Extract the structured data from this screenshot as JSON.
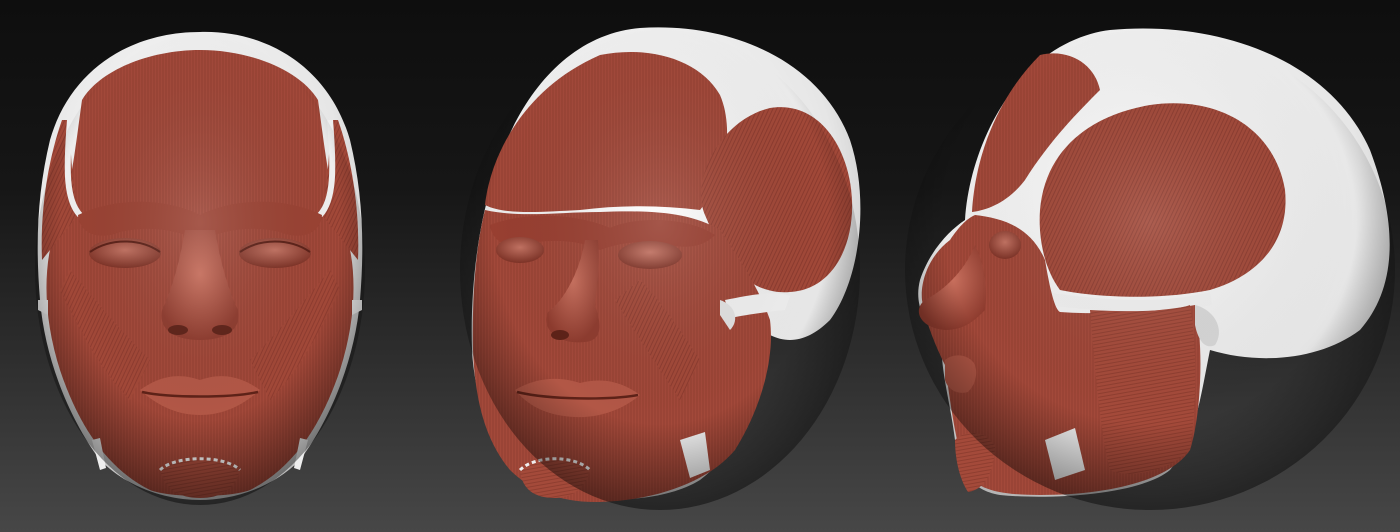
{
  "scene": {
    "colors": {
      "background_top": "#0e0e0e",
      "background_bottom": "#474747",
      "muscle": "#a3493a",
      "muscle_shadow": "#6b2a20",
      "muscle_highlight": "#c46a58",
      "bone": "#eeeeee",
      "bone_shadow": "#b8b8b8"
    },
    "views": [
      {
        "name": "front-view",
        "label": ""
      },
      {
        "name": "three-quarter-view",
        "label": ""
      },
      {
        "name": "side-view",
        "label": ""
      }
    ]
  }
}
